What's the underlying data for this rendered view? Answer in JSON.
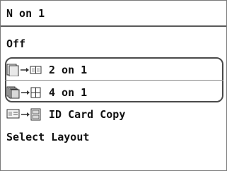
{
  "screen": {
    "title": "N on 1",
    "items": [
      {
        "label": "Off",
        "icon": ""
      },
      {
        "label": "2 on 1",
        "icon": "two-on-one-icon"
      },
      {
        "label": "4 on 1",
        "icon": "four-on-one-icon"
      },
      {
        "label": "ID Card Copy",
        "icon": "id-card-copy-icon"
      },
      {
        "label": "Select Layout",
        "icon": ""
      }
    ]
  }
}
